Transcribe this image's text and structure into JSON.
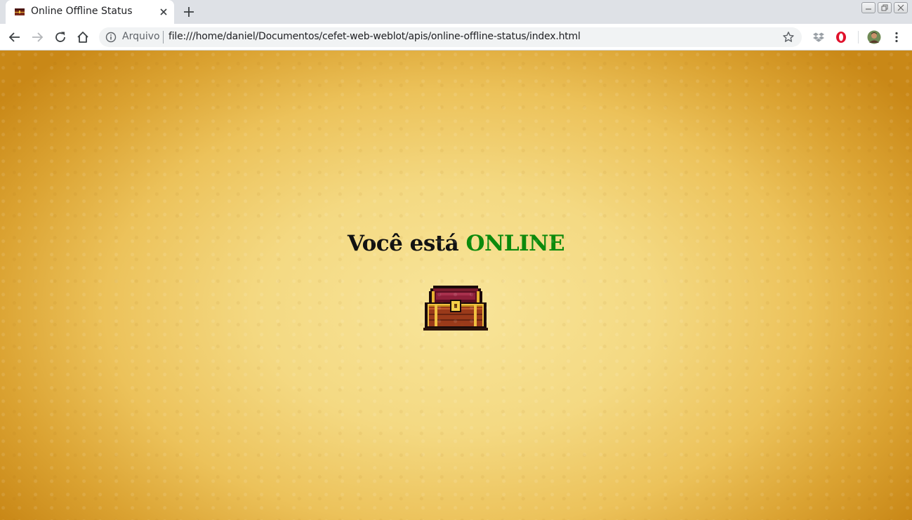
{
  "tab": {
    "title": "Online Offline Status",
    "favicon": "treasure-chest-icon"
  },
  "toolbar": {
    "security_chip": "Arquivo",
    "url": "file:///home/daniel/Documentos/cefet-web-weblot/apis/online-offline-status/index.html"
  },
  "page": {
    "status_prefix": "Você está",
    "status_value": "ONLINE",
    "status_color": "#0c8a0c",
    "image": "treasure-chest-icon"
  }
}
